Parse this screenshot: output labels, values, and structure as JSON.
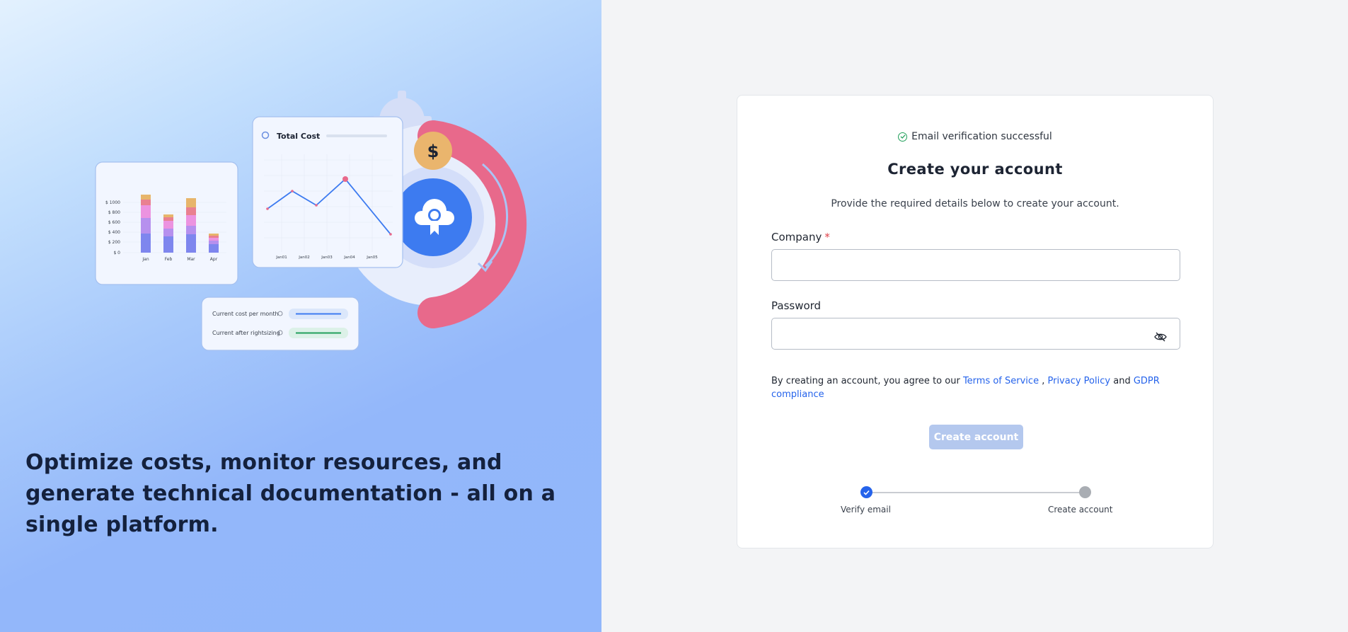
{
  "hero": {
    "tagline": "Optimize costs, monitor resources, and generate technical documentation - all on a single platform.",
    "illustration": {
      "bar_card": {
        "y_ticks": [
          "$ 1000",
          "$ 800",
          "$ 600",
          "$ 400",
          "$ 200",
          "$ 0"
        ],
        "x_labels": [
          "Jan",
          "Feb",
          "Mar",
          "Apr"
        ]
      },
      "line_card": {
        "title": "Total Cost",
        "x_labels": [
          "Jan01",
          "Jan02",
          "Jan03",
          "Jan04",
          "Jan05"
        ]
      },
      "metrics_card": {
        "row1": "Current cost per month",
        "row2": "Current after rightsizing"
      },
      "coin_symbol": "$"
    }
  },
  "form": {
    "verification_text": "Email verification successful",
    "title": "Create your account",
    "subtitle": "Provide the required details below to create your account.",
    "company_label": "Company",
    "required_mark": "*",
    "company_value": "",
    "password_label": "Password",
    "password_value": "",
    "terms": {
      "prefix": "By creating an account, you agree to our",
      "terms_link": "Terms of Service",
      "comma": ",",
      "privacy_link": "Privacy Policy",
      "and": "and",
      "gdpr_link": "GDPR compliance"
    },
    "submit_label": "Create account"
  },
  "stepper": {
    "steps": [
      {
        "label": "Verify email",
        "status": "complete"
      },
      {
        "label": "Create account",
        "status": "current"
      }
    ]
  },
  "colors": {
    "accent": "#2563eb",
    "success": "#22a05b",
    "required": "#e0414a",
    "disabled_button": "#b4c8ee"
  },
  "icons": {
    "verification": "check-circle-icon",
    "password_toggle": "eye-off-icon",
    "step_complete": "checkmark-icon"
  }
}
